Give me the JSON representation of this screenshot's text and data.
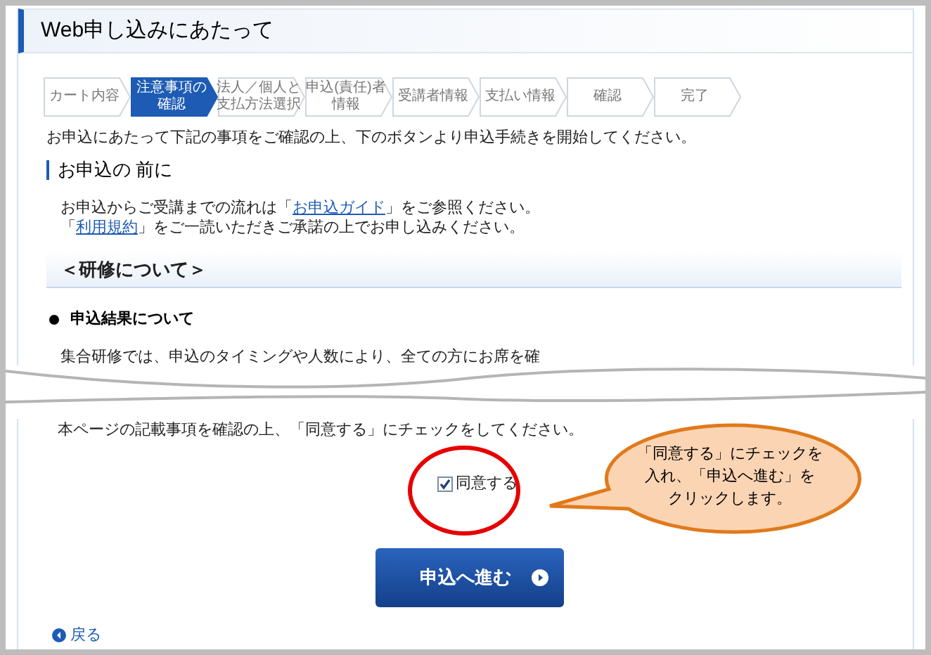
{
  "header": {
    "title": "Web申し込みにあたって"
  },
  "steps": [
    {
      "lines": [
        "カート内容"
      ],
      "selected": false
    },
    {
      "lines": [
        "注意事項の",
        "確認"
      ],
      "selected": true
    },
    {
      "lines": [
        "法人／個人と",
        "支払方法選択"
      ],
      "selected": false
    },
    {
      "lines": [
        "申込(責任)者",
        "情報"
      ],
      "selected": false
    },
    {
      "lines": [
        "受講者情報"
      ],
      "selected": false
    },
    {
      "lines": [
        "支払い情報"
      ],
      "selected": false
    },
    {
      "lines": [
        "確認"
      ],
      "selected": false
    },
    {
      "lines": [
        "完了"
      ],
      "selected": false
    }
  ],
  "intro": "お申込にあたって下記の事項をご確認の上、下のボタンより申込手続きを開始してください。",
  "section": {
    "heading": "お申込の 前に",
    "paragraphs": [
      [
        {
          "kind": "text",
          "text": "お申込からご受講までの流れは「"
        },
        {
          "kind": "link",
          "text": "お申込ガイド"
        },
        {
          "kind": "text",
          "text": "」をご参照ください。"
        }
      ],
      [
        {
          "kind": "text",
          "text": "「"
        },
        {
          "kind": "link",
          "text": "利用規約"
        },
        {
          "kind": "text",
          "text": "」をご一読いただきご承諾の上でお申し込みください。"
        }
      ]
    ]
  },
  "subheading": "＜研修について＞",
  "bullet_heading": "申込結果について",
  "bullet_text": "集合研修では、申込のタイミングや人数により、全ての方にお席を確",
  "agree_instruction": "本ページの記載事項を確認の上、「同意する」にチェックをしてください。",
  "agree": {
    "label": "同意する",
    "checked": true
  },
  "submit": {
    "label": "申込へ進む"
  },
  "back": {
    "label": "戻る"
  },
  "callout": {
    "lines": [
      "「同意する」にチェックを",
      "入れ、「申込へ進む」を",
      "クリックします。"
    ]
  }
}
